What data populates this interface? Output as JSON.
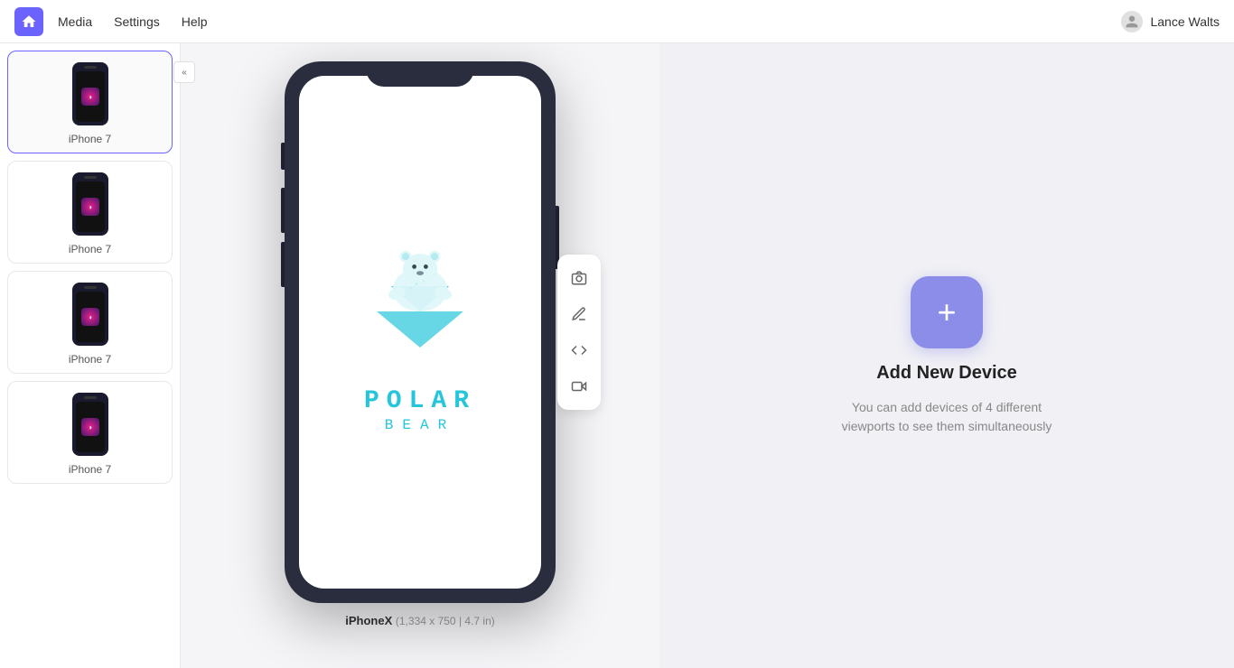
{
  "header": {
    "logo_label": "Home",
    "nav": [
      {
        "id": "media",
        "label": "Media"
      },
      {
        "id": "settings",
        "label": "Settings"
      },
      {
        "id": "help",
        "label": "Help"
      }
    ],
    "user": {
      "name": "Lance Walts",
      "icon": "👤"
    }
  },
  "sidebar": {
    "toggle_label": "«",
    "devices": [
      {
        "id": "device-1",
        "label": "iPhone 7"
      },
      {
        "id": "device-2",
        "label": "iPhone 7"
      },
      {
        "id": "device-3",
        "label": "iPhone 7"
      },
      {
        "id": "device-4",
        "label": "iPhone 7"
      }
    ]
  },
  "center_panel": {
    "device_name": "iPhoneX",
    "device_specs": "(1,334 x 750 | 4.7 in)",
    "app_name_line1": "POLAR",
    "app_name_line2": "BEAR"
  },
  "toolbar": {
    "buttons": [
      {
        "id": "screenshot",
        "icon": "📷",
        "label": "Screenshot"
      },
      {
        "id": "annotate",
        "icon": "🏷",
        "label": "Annotate"
      },
      {
        "id": "code",
        "icon": "<>",
        "label": "Code"
      },
      {
        "id": "video",
        "icon": "🎬",
        "label": "Video"
      }
    ]
  },
  "right_panel": {
    "add_button_label": "+",
    "title": "Add New Device",
    "description": "You can add devices of 4 different viewports to see them simultaneously"
  },
  "colors": {
    "accent": "#6c63ff",
    "add_btn": "#8b8de8",
    "phone_frame": "#2a2d3e",
    "polar_blue": "#26c6da"
  }
}
